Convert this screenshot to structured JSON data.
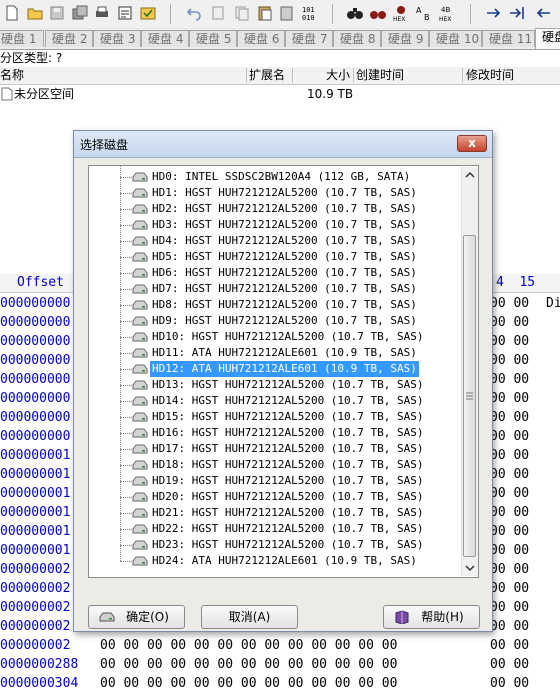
{
  "tabs": [
    "硬盘 1",
    "硬盘 2",
    "硬盘 3",
    "硬盘 4",
    "硬盘 5",
    "硬盘 6",
    "硬盘 7",
    "硬盘 8",
    "硬盘 9",
    "硬盘 10",
    "硬盘 11",
    "硬盘"
  ],
  "partition_type_label": "分区类型: ?",
  "list_header": {
    "name": "名称",
    "ext": "扩展名",
    "size": "大小",
    "created": "创建时间",
    "modified": "修改时间"
  },
  "file_row": {
    "name": "未分区空间",
    "size": "10.9 TB"
  },
  "hex": {
    "offset_label": "Offset",
    "col_14_15": "4  15",
    "right_fragment": "Di",
    "offsets": [
      "000000000",
      "000000000",
      "000000000",
      "000000000",
      "000000000",
      "000000000",
      "000000000",
      "000000000",
      "000000001",
      "000000001",
      "000000001",
      "000000001",
      "000000001",
      "000000001",
      "000000002",
      "000000002",
      "000000002",
      "000000002",
      "000000002",
      "0000000288",
      "0000000304"
    ],
    "bytes_left": "00 00 00 00 00 00 00 00 00 00 00 00 00",
    "bytes_right": "00 00"
  },
  "dialog": {
    "title": "选择磁盘",
    "close_glyph": "x",
    "disks": [
      "HD0: INTEL SSDSC2BW120A4 (112 GB, SATA)",
      "HD1: HGST HUH721212AL5200 (10.7 TB, SAS)",
      "HD2: HGST HUH721212AL5200 (10.7 TB, SAS)",
      "HD3: HGST HUH721212AL5200 (10.7 TB, SAS)",
      "HD4: HGST HUH721212AL5200 (10.7 TB, SAS)",
      "HD5: HGST HUH721212AL5200 (10.7 TB, SAS)",
      "HD6: HGST HUH721212AL5200 (10.7 TB, SAS)",
      "HD7: HGST HUH721212AL5200 (10.7 TB, SAS)",
      "HD8: HGST HUH721212AL5200 (10.7 TB, SAS)",
      "HD9: HGST HUH721212AL5200 (10.7 TB, SAS)",
      "HD10: HGST HUH721212AL5200 (10.7 TB, SAS)",
      "HD11: ATA HUH721212ALE601 (10.9 TB, SAS)",
      "HD12: ATA HUH721212ALE601 (10.9 TB, SAS)",
      "HD13: HGST HUH721212AL5200 (10.7 TB, SAS)",
      "HD14: HGST HUH721212AL5200 (10.7 TB, SAS)",
      "HD15: HGST HUH721212AL5200 (10.7 TB, SAS)",
      "HD16: HGST HUH721212AL5200 (10.7 TB, SAS)",
      "HD17: HGST HUH721212AL5200 (10.7 TB, SAS)",
      "HD18: HGST HUH721212AL5200 (10.7 TB, SAS)",
      "HD19: HGST HUH721212AL5200 (10.7 TB, SAS)",
      "HD20: HGST HUH721212AL5200 (10.7 TB, SAS)",
      "HD21: HGST HUH721212AL5200 (10.7 TB, SAS)",
      "HD22: HGST HUH721212AL5200 (10.7 TB, SAS)",
      "HD23: HGST HUH721212AL5200 (10.7 TB, SAS)",
      "HD24: ATA HUH721212ALE601 (10.9 TB, SAS)"
    ],
    "selected_index": 12,
    "ok_label": "确定(O)",
    "cancel_label": "取消(A)",
    "help_label": "帮助(H)"
  },
  "colors": {
    "selection": "#3399ff",
    "offset_text": "#0000c0"
  }
}
